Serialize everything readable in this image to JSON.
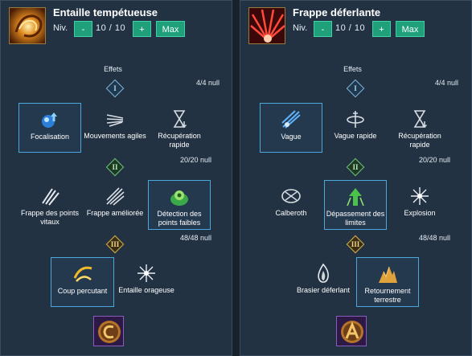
{
  "panels": [
    {
      "title": "Entaille tempétueuse",
      "level_label": "Niv.",
      "minus": "-",
      "level": "10 / 10",
      "plus": "+",
      "max": "Max",
      "effects_label": "Effets",
      "tiers": [
        {
          "numeral": "I",
          "count": "4/4 null",
          "nodes": [
            {
              "label": "Focalisation",
              "icon": "focus-orb-icon",
              "selected": true
            },
            {
              "label": "Mouvements agiles",
              "icon": "swift-motion-icon",
              "selected": false
            },
            {
              "label": "Récupération rapide",
              "icon": "hourglass-icon",
              "selected": false
            }
          ]
        },
        {
          "numeral": "II",
          "count": "20/20 null",
          "nodes": [
            {
              "label": "Frappe des points vitaux",
              "icon": "claw-slash-icon",
              "selected": false
            },
            {
              "label": "Frappe améliorée",
              "icon": "blade-rays-icon",
              "selected": false
            },
            {
              "label": "Détection des points faibles",
              "icon": "green-crest-icon",
              "selected": true
            }
          ]
        },
        {
          "numeral": "III",
          "count": "48/48 null",
          "nodes": [
            {
              "label": "Coup percutant",
              "icon": "golden-arc-icon",
              "selected": true
            },
            {
              "label": "Entaille orageuse",
              "icon": "spark-burst-icon",
              "selected": false
            }
          ]
        }
      ],
      "rune_icon": "rune-c-icon"
    },
    {
      "title": "Frappe déferlante",
      "level_label": "Niv.",
      "minus": "-",
      "level": "10 / 10",
      "plus": "+",
      "max": "Max",
      "effects_label": "Effets",
      "tiers": [
        {
          "numeral": "I",
          "count": "4/4 null",
          "nodes": [
            {
              "label": "Vague",
              "icon": "wave-slash-icon",
              "selected": true
            },
            {
              "label": "Vague rapide",
              "icon": "whirl-icon",
              "selected": false
            },
            {
              "label": "Récupération rapide",
              "icon": "hourglass-icon",
              "selected": false
            }
          ]
        },
        {
          "numeral": "II",
          "count": "20/20 null",
          "nodes": [
            {
              "label": "Calberoth",
              "icon": "compass-icon",
              "selected": false
            },
            {
              "label": "Dépassement des limites",
              "icon": "green-up-arrow-icon",
              "selected": true
            },
            {
              "label": "Explosion",
              "icon": "spark-burst-icon",
              "selected": false
            }
          ]
        },
        {
          "numeral": "III",
          "count": "48/48 null",
          "nodes": [
            {
              "label": "Brasier déferlant",
              "icon": "flame-icon",
              "selected": false
            },
            {
              "label": "Retournement terrestre",
              "icon": "rock-spikes-icon",
              "selected": true
            }
          ]
        }
      ],
      "rune_icon": "rune-a-icon"
    }
  ]
}
